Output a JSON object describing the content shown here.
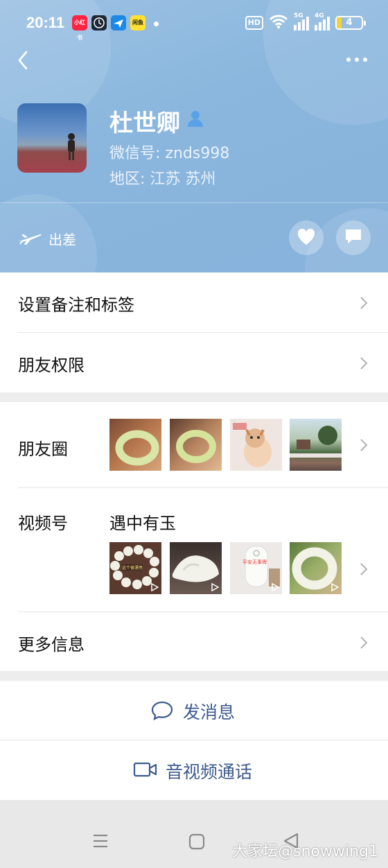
{
  "status_bar": {
    "time": "20:11",
    "apps": [
      {
        "name": "xiaohongshu-icon",
        "text": "小红书",
        "color": "#ff2442"
      },
      {
        "name": "clock-app-icon",
        "text": "",
        "color": "#1d2633"
      },
      {
        "name": "plane-app-icon",
        "text": "",
        "color": "#1e88e5"
      },
      {
        "name": "xianyu-app-icon",
        "text": "闲鱼",
        "color": "#ffe033"
      }
    ],
    "hd": "HD",
    "net1": "5G",
    "net2": "4G",
    "battery": "4",
    "colors": {
      "battery_fill": "#f4d23a"
    }
  },
  "profile": {
    "name": "杜世卿",
    "wechat_id": "微信号: znds998",
    "region": "地区: 江苏  苏州",
    "status": "出差"
  },
  "menu": {
    "remark_tags": "设置备注和标签",
    "friend_permissions": "朋友权限",
    "moments": "朋友圈",
    "channels": "视频号",
    "channels_name": "遇中有玉",
    "more_info": "更多信息"
  },
  "channel_captions": [
    "这个很漂亮",
    "平安无事牌"
  ],
  "actions": {
    "message": "发消息",
    "av_call": "音视频通话"
  },
  "watermark": "大家坛@snowwing1",
  "colors": {
    "header": "#8db8df",
    "action_text": "#3c5a8e",
    "page_bg": "#ededed"
  }
}
